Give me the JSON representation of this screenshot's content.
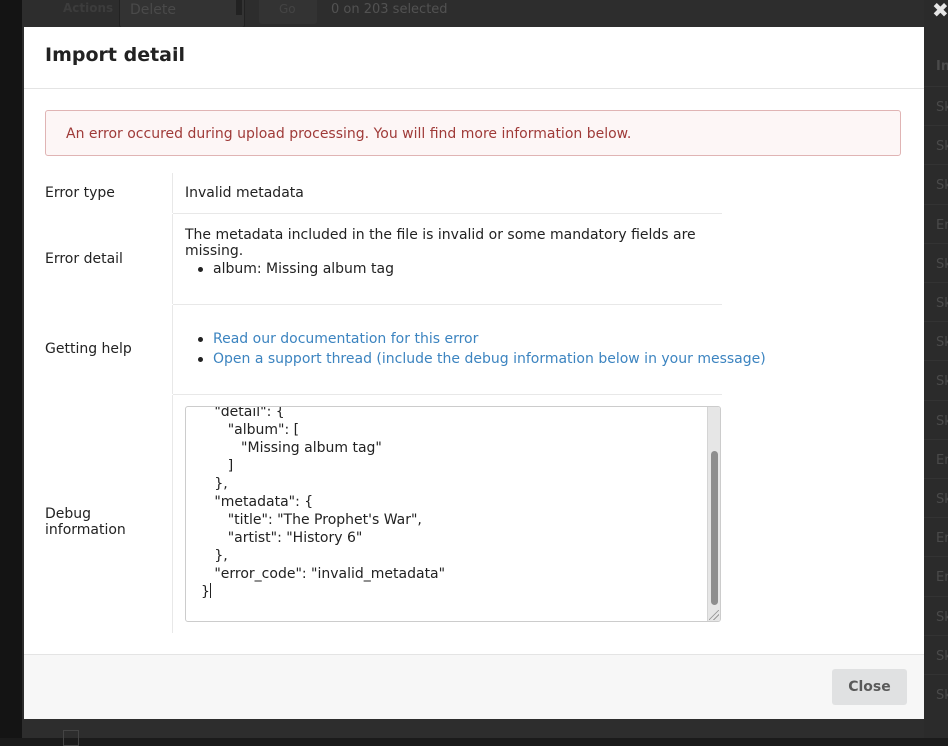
{
  "background": {
    "actions_label": "Actions",
    "action_select_value": "Delete",
    "go_label": "Go",
    "selection_counter": "0 on 203 selected",
    "column_header": "In",
    "column_cells": [
      "Sk",
      "Sk",
      "Sk",
      "Er",
      "Sk",
      "Sk",
      "Sk",
      "Sk",
      "Sk",
      "Er",
      "Sk",
      "Er",
      "Er",
      "Sk",
      "Sk",
      "Sk"
    ]
  },
  "modal": {
    "title": "Import detail",
    "alert_text": "An error occured during upload processing. You will find more information below.",
    "rows": {
      "error_type": {
        "label": "Error type",
        "value": "Invalid metadata"
      },
      "error_detail": {
        "label": "Error detail",
        "value": "The metadata included in the file is invalid or some mandatory fields are missing.",
        "items": [
          "album: Missing album tag"
        ]
      },
      "getting_help": {
        "label": "Getting help",
        "links": [
          "Read our documentation for this error",
          "Open a support thread (include the debug information below in your message)"
        ]
      },
      "debug": {
        "label": "Debug information",
        "code_lines": [
          "   \"detail\": {",
          "      \"album\": [",
          "         \"Missing album tag\"",
          "      ]",
          "   },",
          "   \"metadata\": {",
          "      \"title\": \"The Prophet's War\",",
          "      \"artist\": \"History 6\"",
          "   },",
          "   \"error_code\": \"invalid_metadata\"",
          "}"
        ]
      }
    },
    "close_label": "Close"
  },
  "colors": {
    "alert_text": "#9f3a38",
    "alert_bg": "#fdf6f6",
    "link": "#3c84c0",
    "overlay": "#2d2d2d"
  }
}
